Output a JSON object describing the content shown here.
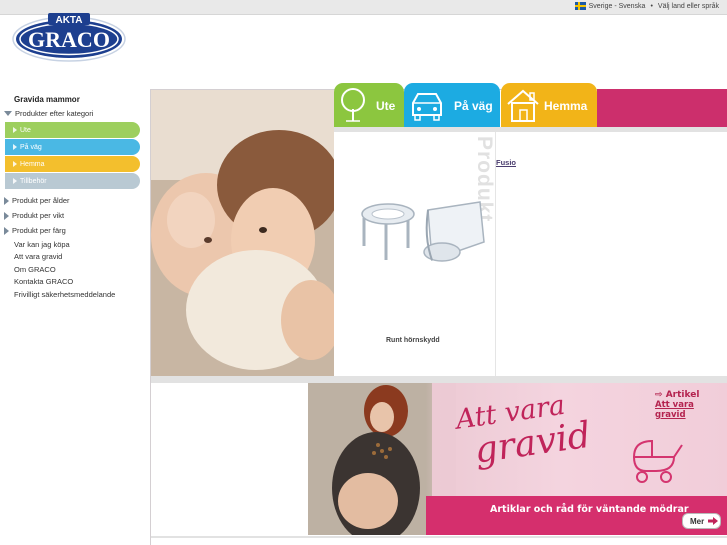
{
  "header": {
    "locale_text": "Sverige - Svenska",
    "separator": "•",
    "change_locale_link": "Välj land eller språk",
    "flag_icon": "sweden-flag-icon"
  },
  "logo": {
    "top_text": "AKTA",
    "brand_text": "GRACO"
  },
  "sidebar": {
    "title": "Gravida mammor",
    "by_category": "Produkter efter kategori",
    "categories": [
      {
        "label": "Ute",
        "color": "#9dcf5e"
      },
      {
        "label": "På väg",
        "color": "#4ab8e4"
      },
      {
        "label": "Hemma",
        "color": "#f3bf2d"
      },
      {
        "label": "Tillbehör",
        "color": "#b9c9d3"
      }
    ],
    "by_age": "Produkt per ålder",
    "by_weight": "Produkt per vikt",
    "by_color": "Produkt per färg",
    "links": [
      "Var kan jag köpa",
      "Att vara gravid",
      "Om GRACO",
      "Kontakta GRACO",
      "Frivilligt säkerhetsmeddelande"
    ]
  },
  "tabs": [
    {
      "label": "Ute",
      "color": "#8cc63f",
      "icon": "tree-icon"
    },
    {
      "label": "På väg",
      "color": "#1cabe2",
      "icon": "car-icon"
    },
    {
      "label": "Hemma",
      "color": "#f2b418",
      "icon": "house-icon"
    }
  ],
  "product_panel": {
    "vertical_watermark": "Produkt",
    "product_label": "Runt hörnskydd",
    "side_link": "Fusio"
  },
  "banner": {
    "article_label": "Artikel",
    "article_link": "Att vara gravid",
    "headline_line1": "Att vara",
    "headline_line2": "gravid",
    "subtitle": "Artiklar och råd för väntande mödrar",
    "more_button": "Mer",
    "pram_icon": "pram-icon"
  }
}
